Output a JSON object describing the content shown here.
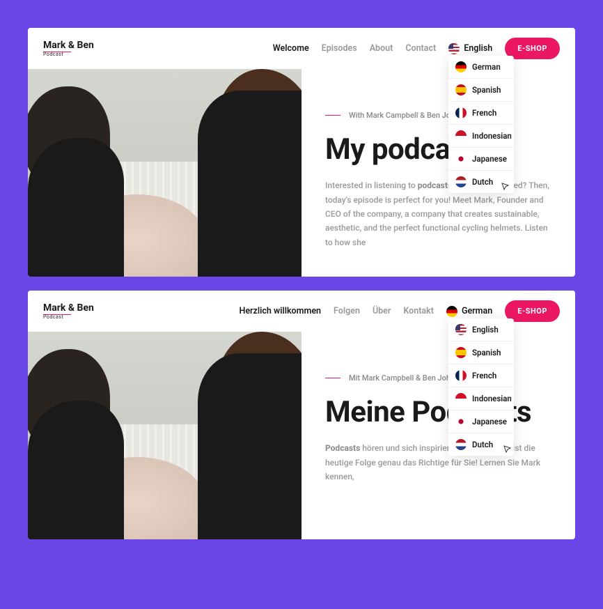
{
  "frames": [
    {
      "logo": {
        "brand": "Mark & Ben",
        "subtitle": "Podcast"
      },
      "nav": {
        "welcome": "Welcome",
        "episodes": "Episodes",
        "about": "About",
        "contact": "Contact"
      },
      "language": {
        "current": "English",
        "flag": "us"
      },
      "dropdown": [
        {
          "label": "German",
          "flag": "de"
        },
        {
          "label": "Spanish",
          "flag": "es"
        },
        {
          "label": "French",
          "flag": "fr"
        },
        {
          "label": "Indonesian",
          "flag": "id"
        },
        {
          "label": "Japanese",
          "flag": "jp"
        },
        {
          "label": "Dutch",
          "flag": "nl"
        }
      ],
      "eshop": "E-SHOP",
      "hero": {
        "author": "With Mark Campbell & Ben John",
        "heading": "My podcasts",
        "desc_pre": "Interested in listening to ",
        "desc_strong": "podcasts",
        "desc_post": " and being inspired? Then, today's episode is perfect for you! Meet Mark, Founder and CEO of the company, a company that creates sustainable, aesthetic, and the perfect functional cycling helmets. Listen to how she"
      }
    },
    {
      "logo": {
        "brand": "Mark & Ben",
        "subtitle": "Podcast"
      },
      "nav": {
        "welcome": "Herzlich willkommen",
        "episodes": "Folgen",
        "about": "Über",
        "contact": "Kontakt"
      },
      "language": {
        "current": "German",
        "flag": "de"
      },
      "dropdown": [
        {
          "label": "English",
          "flag": "us"
        },
        {
          "label": "Spanish",
          "flag": "es"
        },
        {
          "label": "French",
          "flag": "fr"
        },
        {
          "label": "Indonesian",
          "flag": "id"
        },
        {
          "label": "Japanese",
          "flag": "jp"
        },
        {
          "label": "Dutch",
          "flag": "nl"
        }
      ],
      "eshop": "E-SHOP",
      "hero": {
        "author": "Mit Mark Campbell & Ben Joh",
        "heading": "Meine Podcasts",
        "desc_pre": "",
        "desc_strong": "Podcasts",
        "desc_post": " hören und sich inspirieren lassen? Dann ist die heutige Folge genau das Richtige für Sie! Lernen Sie Mark kennen,"
      }
    }
  ]
}
